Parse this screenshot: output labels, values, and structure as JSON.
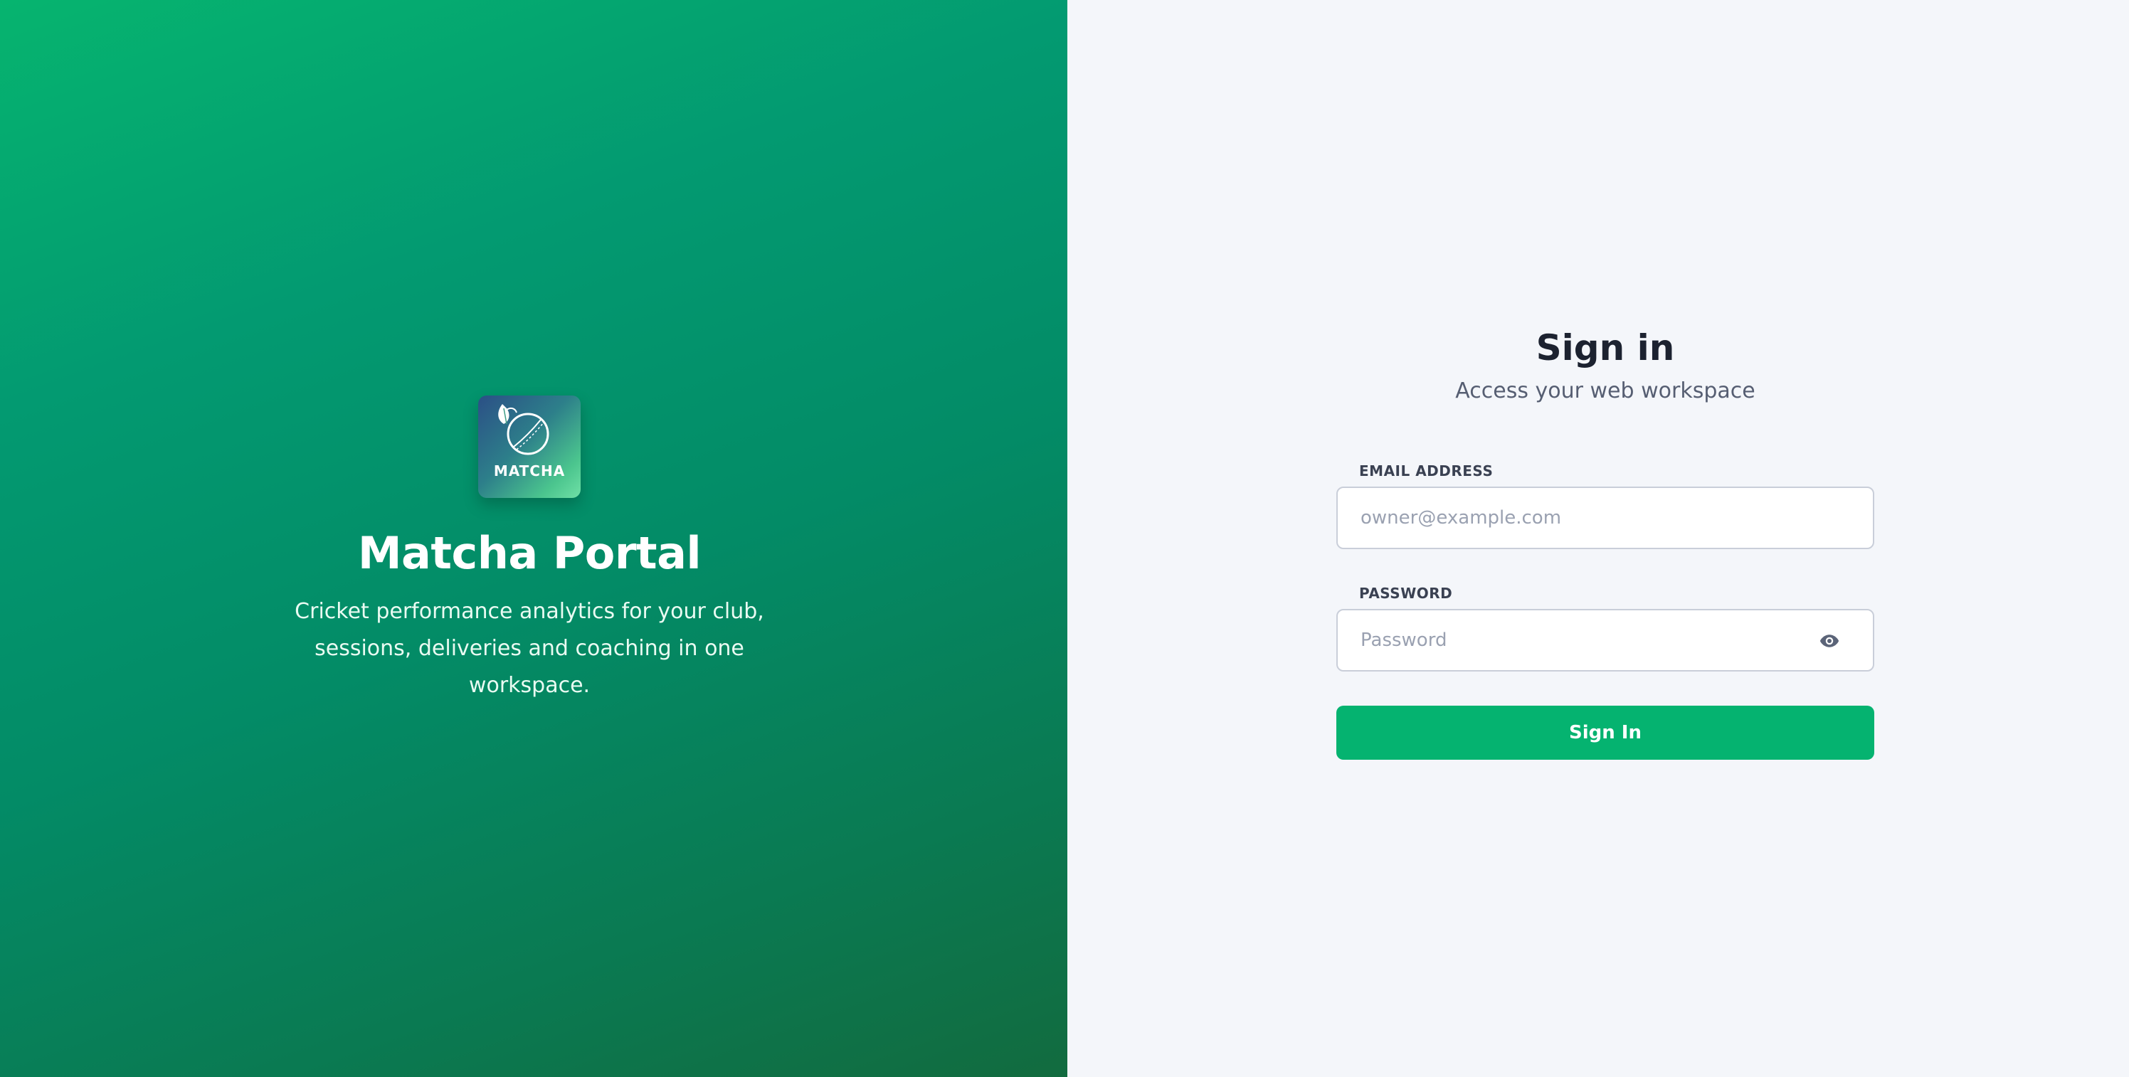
{
  "brand": {
    "logo_text": "MATCHA",
    "title": "Matcha Portal",
    "description": "Cricket performance analytics for your club, sessions, deliveries and coaching in one workspace."
  },
  "signin": {
    "title": "Sign in",
    "subtitle": "Access your web workspace",
    "email": {
      "label": "EMAIL ADDRESS",
      "value": "",
      "placeholder": "owner@example.com"
    },
    "password": {
      "label": "PASSWORD",
      "value": "",
      "placeholder": "Password",
      "toggle_icon": "eye-icon"
    },
    "submit_label": "Sign In"
  },
  "colors": {
    "brand_green": "#05b370",
    "panel_background": "#f4f6fa",
    "heading_text": "#1c2230"
  }
}
